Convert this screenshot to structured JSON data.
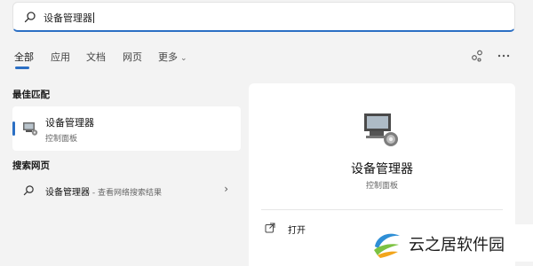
{
  "search": {
    "query": "设备管理器"
  },
  "tabs": [
    {
      "label": "全部"
    },
    {
      "label": "应用"
    },
    {
      "label": "文档"
    },
    {
      "label": "网页"
    },
    {
      "label": "更多"
    }
  ],
  "icons": {
    "search": "search-icon",
    "share": "share-icon",
    "more": "more-icon",
    "app": "device-manager-icon",
    "open": "open-icon",
    "chevron": "chevron-right-icon"
  },
  "best_match": {
    "section_title": "最佳匹配",
    "title": "设备管理器",
    "subtitle": "控制面板"
  },
  "web_search": {
    "section_title": "搜索网页",
    "query_text": "设备管理器",
    "suffix": " - 查看网络搜索结果"
  },
  "detail": {
    "name": "设备管理器",
    "kind": "控制面板",
    "actions": [
      {
        "label": "打开"
      }
    ]
  },
  "watermark": {
    "text": "云之居软件园"
  },
  "colors": {
    "accent": "#2b6fc4",
    "background": "#f3f3f3",
    "card": "#ffffff"
  }
}
